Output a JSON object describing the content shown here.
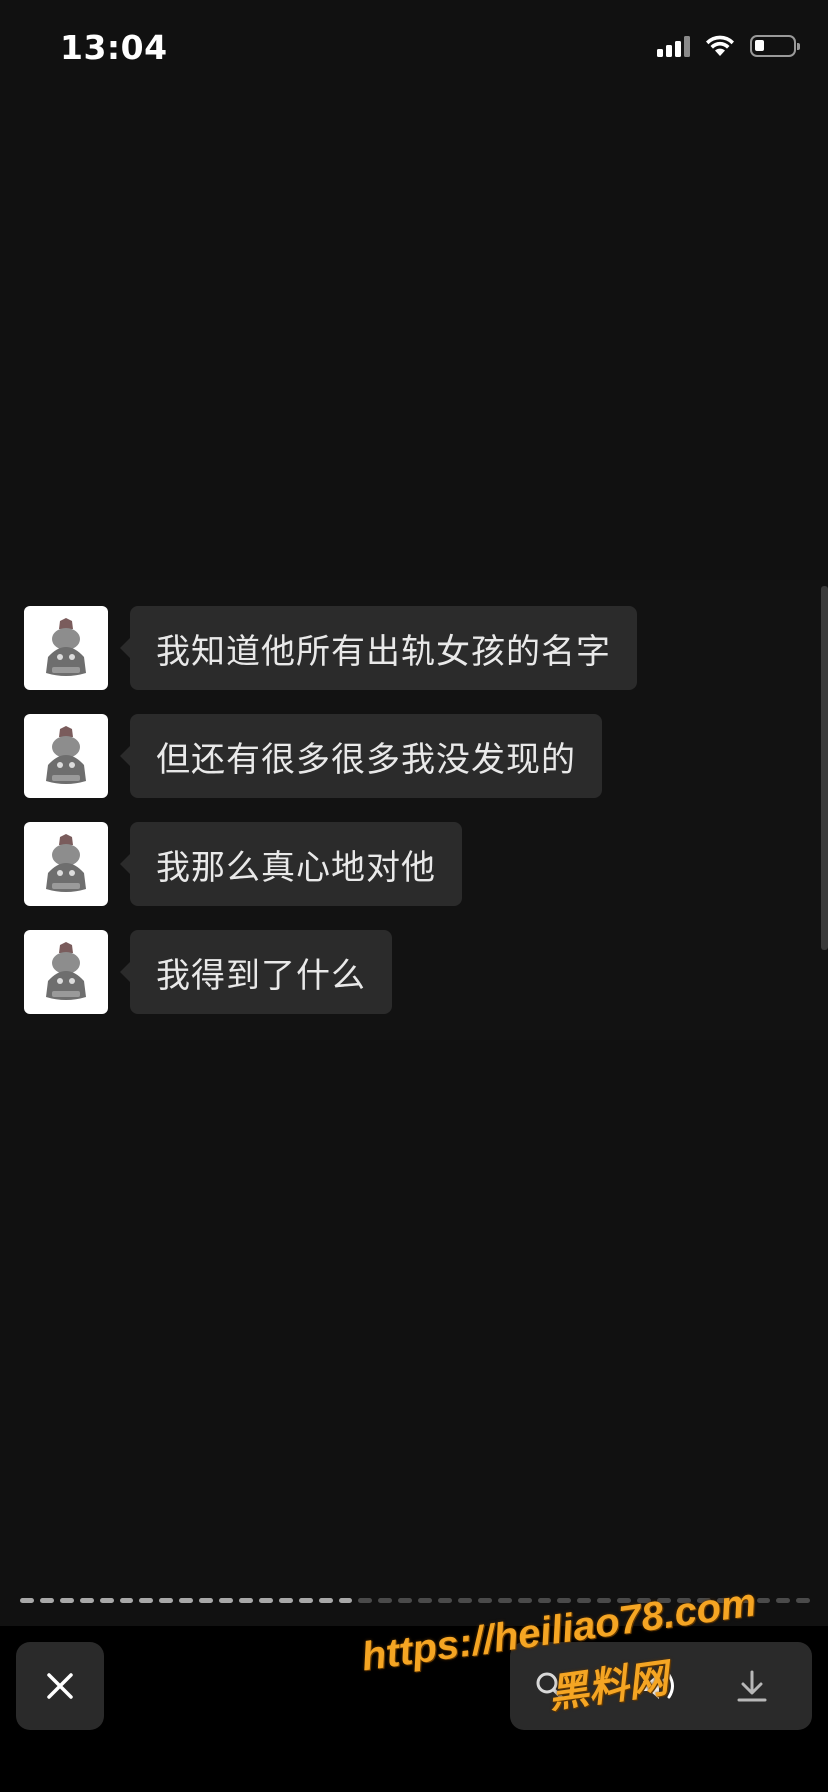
{
  "status_bar": {
    "time": "13:04",
    "icons": [
      "signal-icon",
      "wifi-icon",
      "battery-icon"
    ]
  },
  "chat": {
    "messages": [
      {
        "text": "我知道他所有出轨女孩的名字"
      },
      {
        "text": "但还有很多很多我没发现的"
      },
      {
        "text": "我那么真心地对他"
      },
      {
        "text": "我得到了什么"
      }
    ]
  },
  "playback": {
    "segments_total": 40,
    "segments_done": 17
  },
  "bottom_bar": {
    "icons": [
      "close-icon",
      "search-icon",
      "speaker-icon",
      "download-icon"
    ]
  },
  "watermark": {
    "url": "https://heiliao78.com",
    "name": "黑料网"
  },
  "colors": {
    "background": "#111111",
    "bubble": "#2b2b2b",
    "watermark": "#f5a523"
  }
}
